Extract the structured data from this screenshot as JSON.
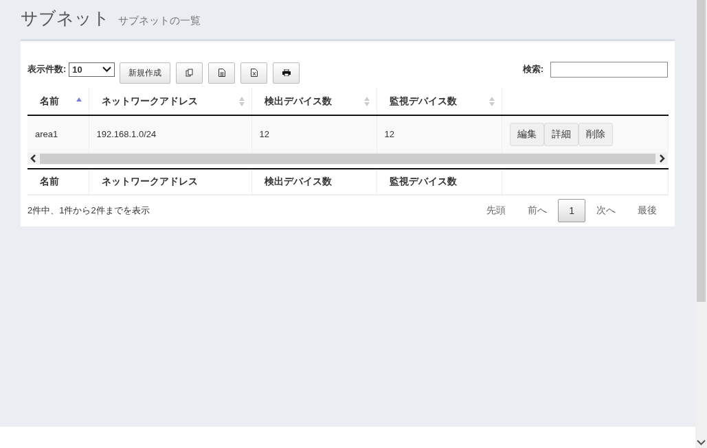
{
  "header": {
    "title": "サブネット",
    "subtitle": "サブネットの一覧"
  },
  "toolbar": {
    "page_length_label": "表示件数:",
    "page_length": "10",
    "buttons": [
      {
        "kind": "text",
        "label": "新規作成"
      },
      {
        "kind": "copy"
      },
      {
        "kind": "csv"
      },
      {
        "kind": "excel"
      },
      {
        "kind": "print"
      }
    ],
    "search_label": "検索:"
  },
  "table": {
    "columns": [
      {
        "label": "名前",
        "sorted_ascending": true
      },
      {
        "label": "ネットワークアドレス",
        "sorted_ascending": false
      },
      {
        "label": "検出デバイス数",
        "sorted_ascending": false
      },
      {
        "label": "監視デバイス数",
        "sorted_ascending": false
      }
    ],
    "rows": [
      {
        "cells": [
          "area1",
          "192.168.1.0/24",
          "12",
          "12"
        ],
        "actions": [
          "編集",
          "詳細",
          "削除"
        ]
      }
    ],
    "footer": [
      "名前",
      "ネットワークアドレス",
      "検出デバイス数",
      "監視デバイス数"
    ]
  },
  "info": "2件中、1件から2件までを表示",
  "pagination": [
    {
      "label": "先頭",
      "selected": false
    },
    {
      "label": "前へ",
      "selected": false
    },
    {
      "label": "1",
      "selected": true
    },
    {
      "label": "次へ",
      "selected": false
    },
    {
      "label": "最後",
      "selected": false
    }
  ]
}
